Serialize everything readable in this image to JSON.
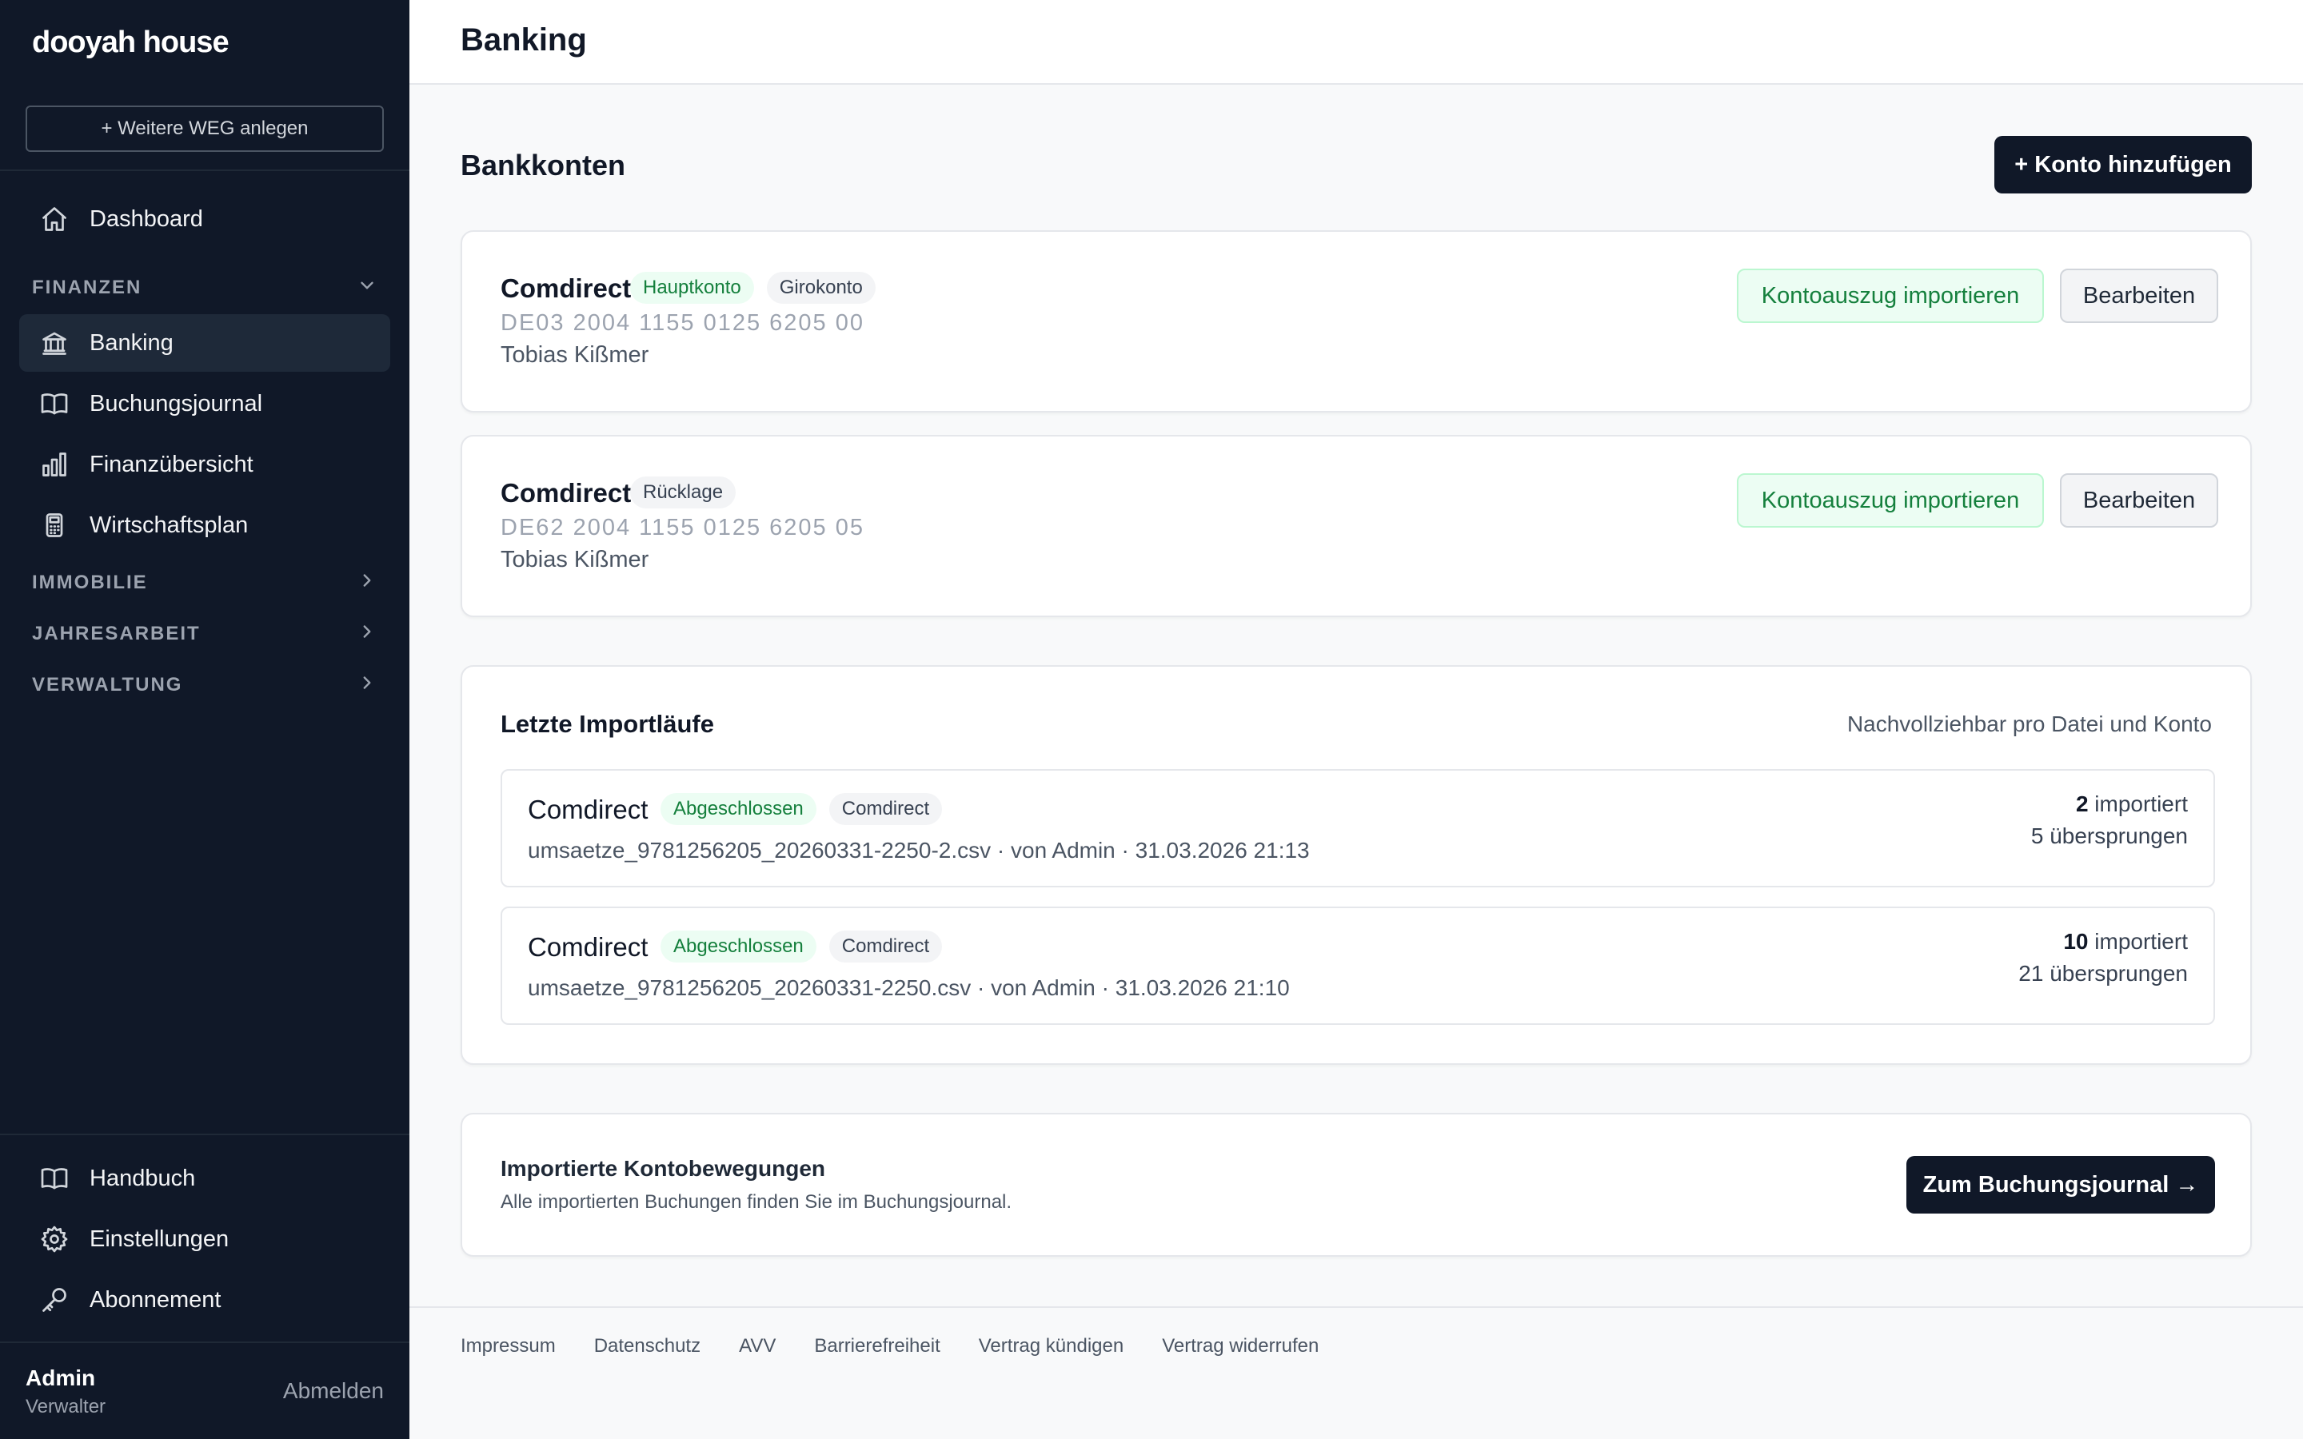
{
  "app": {
    "brand": "dooyah house"
  },
  "sidebar": {
    "add_weg_label": "+ Weitere WEG anlegen",
    "dashboard_label": "Dashboard",
    "sections": {
      "finanzen": "FINANZEN",
      "immobilie": "IMMOBILIE",
      "jahresarbeit": "JAHRESARBEIT",
      "verwaltung": "VERWALTUNG"
    },
    "finanzen_items": [
      {
        "label": "Banking",
        "icon": "bank-icon"
      },
      {
        "label": "Buchungsjournal",
        "icon": "book-icon"
      },
      {
        "label": "Finanzübersicht",
        "icon": "bar-chart-icon"
      },
      {
        "label": "Wirtschaftsplan",
        "icon": "calculator-icon"
      }
    ],
    "bottom_items": [
      {
        "label": "Handbuch",
        "icon": "book-icon"
      },
      {
        "label": "Einstellungen",
        "icon": "gear-icon"
      },
      {
        "label": "Abonnement",
        "icon": "key-icon"
      }
    ],
    "user": {
      "name": "Admin",
      "role": "Verwalter",
      "logout_label": "Abmelden"
    }
  },
  "header": {
    "title": "Banking"
  },
  "bank_section": {
    "title": "Bankkonten",
    "add_account_label": "+ Konto hinzufügen",
    "accounts": [
      {
        "bank": "Comdirect",
        "badges": [
          "Hauptkonto",
          "Girokonto"
        ],
        "iban": "DE03 2004 1155 0125 6205 00",
        "owner": "Tobias Kißmer",
        "import_label": "Kontoauszug importieren",
        "edit_label": "Bearbeiten"
      },
      {
        "bank": "Comdirect",
        "badges": [
          "Rücklage"
        ],
        "iban": "DE62 2004 1155 0125 6205 05",
        "owner": "Tobias Kißmer",
        "import_label": "Kontoauszug importieren",
        "edit_label": "Bearbeiten"
      }
    ]
  },
  "imports": {
    "title": "Letzte Importläufe",
    "subtitle": "Nachvollziehbar pro Datei und Konto",
    "runs": [
      {
        "bank": "Comdirect",
        "status": "Abgeschlossen",
        "account": "Comdirect",
        "meta": "umsaetze_9781256205_20260331-2250-2.csv · von Admin · 31.03.2026 21:13",
        "imported_count": "2",
        "imported_label": "importiert",
        "skipped": "5 übersprungen"
      },
      {
        "bank": "Comdirect",
        "status": "Abgeschlossen",
        "account": "Comdirect",
        "meta": "umsaetze_9781256205_20260331-2250.csv · von Admin · 31.03.2026 21:10",
        "imported_count": "10",
        "imported_label": "importiert",
        "skipped": "21 übersprungen"
      }
    ]
  },
  "movements": {
    "title": "Importierte Kontobewegungen",
    "subtitle": "Alle importierten Buchungen finden Sie im Buchungsjournal.",
    "button_label": "Zum Buchungsjournal →"
  },
  "footer": {
    "links": [
      "Impressum",
      "Datenschutz",
      "AVV",
      "Barrierefreiheit",
      "Vertrag kündigen",
      "Vertrag widerrufen"
    ]
  }
}
